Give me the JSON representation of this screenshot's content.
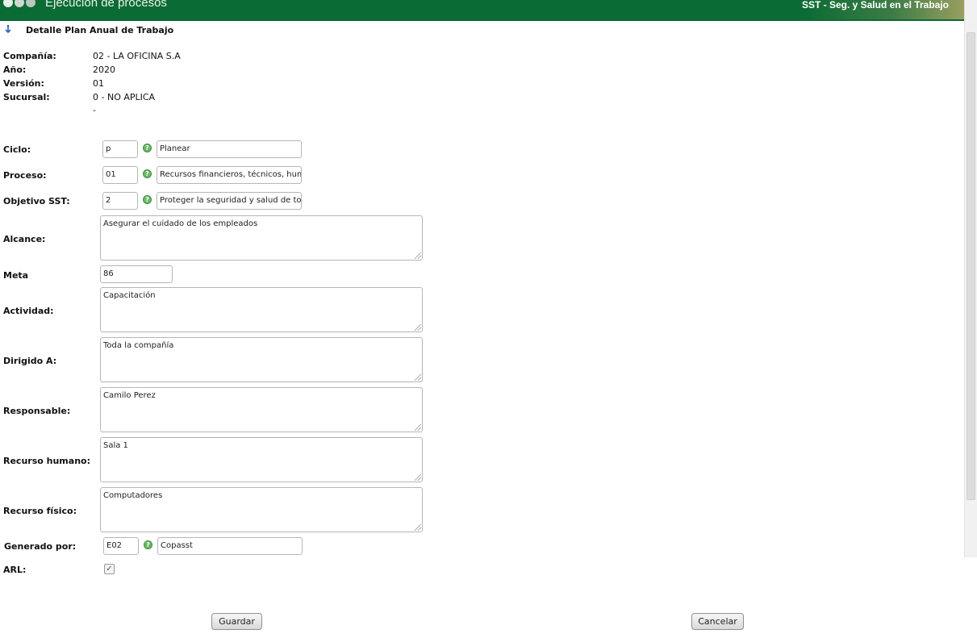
{
  "header": {
    "app_title": "Ejecución de procesos",
    "module_title": "SST - Seg. y Salud en el Trabajo"
  },
  "section": {
    "title": "Detalle Plan Anual de Trabajo",
    "icon": "anchor-down-icon"
  },
  "info": [
    {
      "label": "Compañía:",
      "value": "02 - LA OFICINA S.A"
    },
    {
      "label": "Año:",
      "value": "2020"
    },
    {
      "label": "Versión:",
      "value": "01"
    },
    {
      "label": "Sucursal:",
      "value": "0 - NO APLICA"
    }
  ],
  "info_extra": "-",
  "form": {
    "ciclo": {
      "label": "Ciclo:",
      "code": "p",
      "desc": "Planear"
    },
    "proceso": {
      "label": "Proceso:",
      "code": "01",
      "desc": "Recursos financieros, técnicos,  huma"
    },
    "objetivo": {
      "label": "Objetivo SST:",
      "code": "2",
      "desc": "Proteger la seguridad y salud de todo"
    },
    "alcance": {
      "label": "Alcance:",
      "value": "Asegurar el cuidado de los empleados"
    },
    "meta": {
      "label": "Meta",
      "value": "86"
    },
    "actividad": {
      "label": "Actividad:",
      "value": "Capacitación"
    },
    "dirigido": {
      "label": "Dirigido A:",
      "value": "Toda la compañía"
    },
    "responsable": {
      "label": "Responsable:",
      "value": "Camilo Perez"
    },
    "rec_humano": {
      "label": "Recurso humano:",
      "value": "Sala 1"
    },
    "rec_fisico": {
      "label": "Recurso físico:",
      "value": "Computadores"
    },
    "generado": {
      "label": "Generado por:",
      "code": "E02",
      "desc": "Copasst"
    },
    "arl": {
      "label": "ARL:",
      "checked": true,
      "mark": "✓"
    }
  },
  "help_glyph": "?",
  "buttons": {
    "save": "Guardar",
    "cancel": "Cancelar"
  },
  "colors": {
    "header_bg": "#0b6b34",
    "help_icon": "#6db86a"
  }
}
